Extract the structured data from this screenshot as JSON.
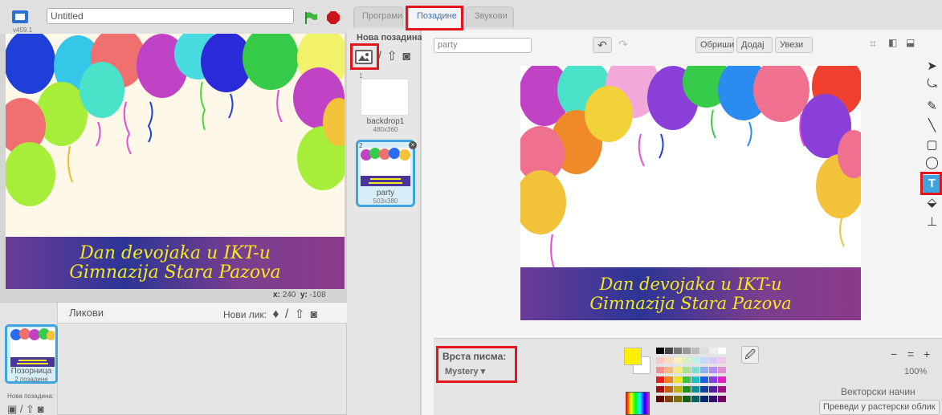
{
  "project": {
    "title": "Untitled",
    "version": "v459.1"
  },
  "stage": {
    "banner_line1": "Dan devojaka u IKT-u",
    "banner_line2": "Gimnazija Stara Pazova",
    "mouse_x_label": "x:",
    "mouse_x": "240",
    "mouse_y_label": "y:",
    "mouse_y": "-108"
  },
  "sprites": {
    "header": "Ликови",
    "new_sprite": "Нови лик:",
    "stage_label": "Позорница",
    "stage_count": "2 позадине",
    "new_backdrop": "Нова позадина:"
  },
  "tabs": [
    {
      "label": "Програми"
    },
    {
      "label": "Позадине"
    },
    {
      "label": "Звукови"
    }
  ],
  "backdrops": {
    "new_label": "Нова позадина:",
    "items": [
      {
        "num": "1",
        "name": "backdrop1",
        "size": "480x360"
      },
      {
        "num": "2",
        "name": "party",
        "size": "503x380"
      }
    ]
  },
  "editor": {
    "costume_name": "party",
    "clear": "Обриши",
    "add": "Додај",
    "import": "Увези",
    "font_label": "Врста писма:",
    "font_value": "Mystery",
    "zoom": "100%",
    "mode": "Векторски начин",
    "convert": "Преведи у растерски облик"
  },
  "colors": {
    "accent": "#3da4e0",
    "highlight": "#e3141b",
    "primary": "#ffef00",
    "banner_text": "#f4e81e"
  }
}
